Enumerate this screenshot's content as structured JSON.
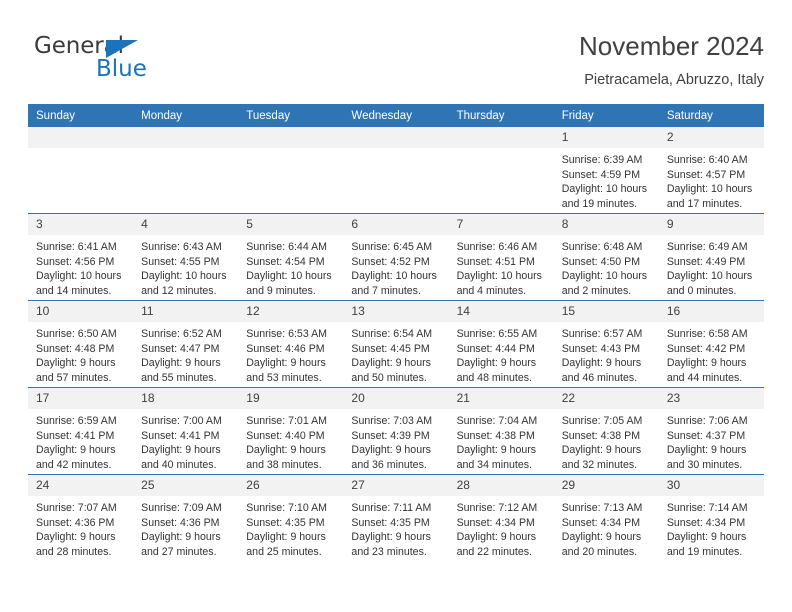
{
  "logo": {
    "word1": "General",
    "word2": "Blue",
    "accent_color": "#1b74bb",
    "triangle_icon": "triangle-icon"
  },
  "header": {
    "month_title": "November 2024",
    "location": "Pietracamela, Abruzzo, Italy"
  },
  "calendar": {
    "header_color": "#2f74b5",
    "daynum_band_color": "#f2f2f2",
    "weekdays": [
      "Sunday",
      "Monday",
      "Tuesday",
      "Wednesday",
      "Thursday",
      "Friday",
      "Saturday"
    ],
    "weeks": [
      [
        {
          "day": "",
          "empty": true,
          "sunrise": "",
          "sunset": "",
          "daylight": ""
        },
        {
          "day": "",
          "empty": true,
          "sunrise": "",
          "sunset": "",
          "daylight": ""
        },
        {
          "day": "",
          "empty": true,
          "sunrise": "",
          "sunset": "",
          "daylight": ""
        },
        {
          "day": "",
          "empty": true,
          "sunrise": "",
          "sunset": "",
          "daylight": ""
        },
        {
          "day": "",
          "empty": true,
          "sunrise": "",
          "sunset": "",
          "daylight": ""
        },
        {
          "day": "1",
          "sunrise": "Sunrise: 6:39 AM",
          "sunset": "Sunset: 4:59 PM",
          "daylight": "Daylight: 10 hours and 19 minutes."
        },
        {
          "day": "2",
          "sunrise": "Sunrise: 6:40 AM",
          "sunset": "Sunset: 4:57 PM",
          "daylight": "Daylight: 10 hours and 17 minutes."
        }
      ],
      [
        {
          "day": "3",
          "sunrise": "Sunrise: 6:41 AM",
          "sunset": "Sunset: 4:56 PM",
          "daylight": "Daylight: 10 hours and 14 minutes."
        },
        {
          "day": "4",
          "sunrise": "Sunrise: 6:43 AM",
          "sunset": "Sunset: 4:55 PM",
          "daylight": "Daylight: 10 hours and 12 minutes."
        },
        {
          "day": "5",
          "sunrise": "Sunrise: 6:44 AM",
          "sunset": "Sunset: 4:54 PM",
          "daylight": "Daylight: 10 hours and 9 minutes."
        },
        {
          "day": "6",
          "sunrise": "Sunrise: 6:45 AM",
          "sunset": "Sunset: 4:52 PM",
          "daylight": "Daylight: 10 hours and 7 minutes."
        },
        {
          "day": "7",
          "sunrise": "Sunrise: 6:46 AM",
          "sunset": "Sunset: 4:51 PM",
          "daylight": "Daylight: 10 hours and 4 minutes."
        },
        {
          "day": "8",
          "sunrise": "Sunrise: 6:48 AM",
          "sunset": "Sunset: 4:50 PM",
          "daylight": "Daylight: 10 hours and 2 minutes."
        },
        {
          "day": "9",
          "sunrise": "Sunrise: 6:49 AM",
          "sunset": "Sunset: 4:49 PM",
          "daylight": "Daylight: 10 hours and 0 minutes."
        }
      ],
      [
        {
          "day": "10",
          "sunrise": "Sunrise: 6:50 AM",
          "sunset": "Sunset: 4:48 PM",
          "daylight": "Daylight: 9 hours and 57 minutes."
        },
        {
          "day": "11",
          "sunrise": "Sunrise: 6:52 AM",
          "sunset": "Sunset: 4:47 PM",
          "daylight": "Daylight: 9 hours and 55 minutes."
        },
        {
          "day": "12",
          "sunrise": "Sunrise: 6:53 AM",
          "sunset": "Sunset: 4:46 PM",
          "daylight": "Daylight: 9 hours and 53 minutes."
        },
        {
          "day": "13",
          "sunrise": "Sunrise: 6:54 AM",
          "sunset": "Sunset: 4:45 PM",
          "daylight": "Daylight: 9 hours and 50 minutes."
        },
        {
          "day": "14",
          "sunrise": "Sunrise: 6:55 AM",
          "sunset": "Sunset: 4:44 PM",
          "daylight": "Daylight: 9 hours and 48 minutes."
        },
        {
          "day": "15",
          "sunrise": "Sunrise: 6:57 AM",
          "sunset": "Sunset: 4:43 PM",
          "daylight": "Daylight: 9 hours and 46 minutes."
        },
        {
          "day": "16",
          "sunrise": "Sunrise: 6:58 AM",
          "sunset": "Sunset: 4:42 PM",
          "daylight": "Daylight: 9 hours and 44 minutes."
        }
      ],
      [
        {
          "day": "17",
          "sunrise": "Sunrise: 6:59 AM",
          "sunset": "Sunset: 4:41 PM",
          "daylight": "Daylight: 9 hours and 42 minutes."
        },
        {
          "day": "18",
          "sunrise": "Sunrise: 7:00 AM",
          "sunset": "Sunset: 4:41 PM",
          "daylight": "Daylight: 9 hours and 40 minutes."
        },
        {
          "day": "19",
          "sunrise": "Sunrise: 7:01 AM",
          "sunset": "Sunset: 4:40 PM",
          "daylight": "Daylight: 9 hours and 38 minutes."
        },
        {
          "day": "20",
          "sunrise": "Sunrise: 7:03 AM",
          "sunset": "Sunset: 4:39 PM",
          "daylight": "Daylight: 9 hours and 36 minutes."
        },
        {
          "day": "21",
          "sunrise": "Sunrise: 7:04 AM",
          "sunset": "Sunset: 4:38 PM",
          "daylight": "Daylight: 9 hours and 34 minutes."
        },
        {
          "day": "22",
          "sunrise": "Sunrise: 7:05 AM",
          "sunset": "Sunset: 4:38 PM",
          "daylight": "Daylight: 9 hours and 32 minutes."
        },
        {
          "day": "23",
          "sunrise": "Sunrise: 7:06 AM",
          "sunset": "Sunset: 4:37 PM",
          "daylight": "Daylight: 9 hours and 30 minutes."
        }
      ],
      [
        {
          "day": "24",
          "sunrise": "Sunrise: 7:07 AM",
          "sunset": "Sunset: 4:36 PM",
          "daylight": "Daylight: 9 hours and 28 minutes."
        },
        {
          "day": "25",
          "sunrise": "Sunrise: 7:09 AM",
          "sunset": "Sunset: 4:36 PM",
          "daylight": "Daylight: 9 hours and 27 minutes."
        },
        {
          "day": "26",
          "sunrise": "Sunrise: 7:10 AM",
          "sunset": "Sunset: 4:35 PM",
          "daylight": "Daylight: 9 hours and 25 minutes."
        },
        {
          "day": "27",
          "sunrise": "Sunrise: 7:11 AM",
          "sunset": "Sunset: 4:35 PM",
          "daylight": "Daylight: 9 hours and 23 minutes."
        },
        {
          "day": "28",
          "sunrise": "Sunrise: 7:12 AM",
          "sunset": "Sunset: 4:34 PM",
          "daylight": "Daylight: 9 hours and 22 minutes."
        },
        {
          "day": "29",
          "sunrise": "Sunrise: 7:13 AM",
          "sunset": "Sunset: 4:34 PM",
          "daylight": "Daylight: 9 hours and 20 minutes."
        },
        {
          "day": "30",
          "sunrise": "Sunrise: 7:14 AM",
          "sunset": "Sunset: 4:34 PM",
          "daylight": "Daylight: 9 hours and 19 minutes."
        }
      ]
    ]
  }
}
